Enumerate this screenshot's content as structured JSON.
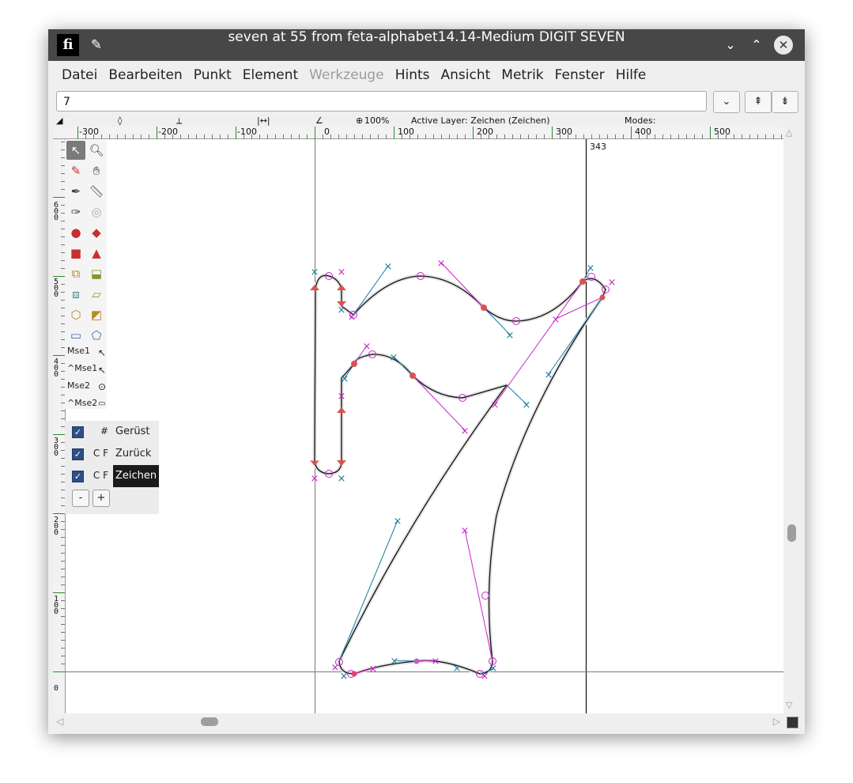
{
  "window": {
    "title": "seven at 55 from feta-alphabet14.14-Medium DIGIT SEVEN",
    "app_icon": "fontforge-app-icon",
    "app_icon_glyph": "ﬁ",
    "pin_glyph": "✎",
    "minimize_glyph": "⌄",
    "maximize_glyph": "⌃",
    "close_glyph": "✕"
  },
  "menu": [
    "Datei",
    "Bearbeiten",
    "Punkt",
    "Element",
    "Werkzeuge",
    "Hints",
    "Ansicht",
    "Metrik",
    "Fenster",
    "Hilfe"
  ],
  "menu_disabled": "Werkzeuge",
  "char_field": {
    "value": "7"
  },
  "buttons": {
    "dropdown": "⌄",
    "prev": "⇞",
    "next": "⇟"
  },
  "infobar": {
    "zoom": "100%",
    "active_layer": "Active Layer: Zeichen (Zeichen)",
    "modes": "Modes:",
    "width_icon_glyph": "|↔|"
  },
  "ruler_h": [
    "-300",
    "-200",
    "-100",
    "0",
    "100",
    "200",
    "300",
    "400",
    "500"
  ],
  "ruler_v": [
    "600",
    "500",
    "400",
    "300",
    "200",
    "100",
    "0"
  ],
  "advance_width": "343",
  "tools": {
    "mse1": "Mse1",
    "ctrl_mse1": "^Mse1",
    "mse2": "Mse2",
    "ctrl_mse2": "^Mse2"
  },
  "layers": {
    "rows": [
      {
        "flags": "#",
        "name": "Gerüst",
        "checked": true,
        "selected": false
      },
      {
        "flags": "C F",
        "name": "Zurück",
        "checked": true,
        "selected": false
      },
      {
        "flags": "C F",
        "name": "Zeichen",
        "checked": true,
        "selected": true
      }
    ],
    "minus": "-",
    "plus": "+"
  },
  "colors": {
    "titlebar": "#474747",
    "window_bg": "#efefef",
    "point_red": "#e05050",
    "control_cyan": "#1a7b9e",
    "control_magenta": "#cc22cc",
    "selected_layer": "#1b1b1b",
    "checkbox": "#2d4f86"
  }
}
